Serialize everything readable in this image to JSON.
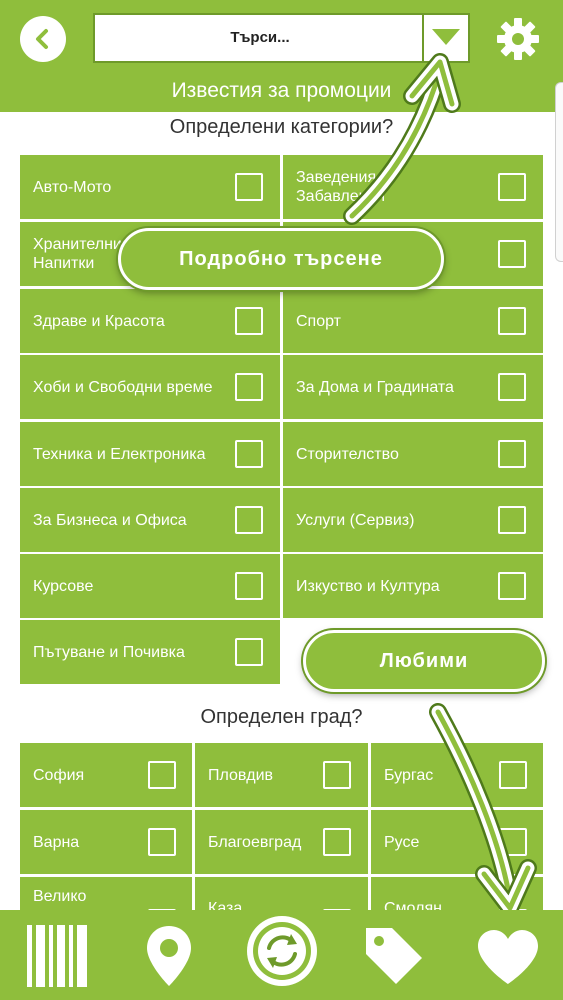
{
  "header": {
    "search_text": "Търси...",
    "title": "Известия за промоции"
  },
  "categories": {
    "title": "Определени категории?",
    "items": [
      {
        "label": "Авто-Мото"
      },
      {
        "label": "Заведения Забавления"
      },
      {
        "label": "Хранителни Напитки"
      },
      {
        "label": ""
      },
      {
        "label": "Здраве и Красота"
      },
      {
        "label": "Спорт"
      },
      {
        "label": "Хоби и Свободни време"
      },
      {
        "label": "За Дома и Градината"
      },
      {
        "label": "Техника и Електроника"
      },
      {
        "label": "Сторителство"
      },
      {
        "label": "За Бизнеса и Офиса"
      },
      {
        "label": "Услуги (Сервиз)"
      },
      {
        "label": "Курсове"
      },
      {
        "label": "Изкуство и Култура"
      },
      {
        "label": "Пътуване и Почивка"
      }
    ]
  },
  "cities": {
    "title": "Определен град?",
    "items": [
      {
        "label": "София"
      },
      {
        "label": "Пловдив"
      },
      {
        "label": "Бургас"
      },
      {
        "label": "Варна"
      },
      {
        "label": "Благоевград"
      },
      {
        "label": "Русе"
      },
      {
        "label": "Велико"
      },
      {
        "label": "Каза"
      },
      {
        "label": "Смолян"
      }
    ]
  },
  "overlays": {
    "advanced_search": "Подробно търсене",
    "favorites": "Любими"
  },
  "icons": {
    "back": "chevron-left-icon",
    "dropdown": "triangle-down-icon",
    "settings": "gear-icon",
    "bottom": [
      "barcode-icon",
      "location-pin-icon",
      "refresh-icon",
      "tag-icon",
      "heart-icon"
    ]
  },
  "colors": {
    "accent": "#8fbe3c",
    "accent_dark": "#6e9a2a"
  }
}
